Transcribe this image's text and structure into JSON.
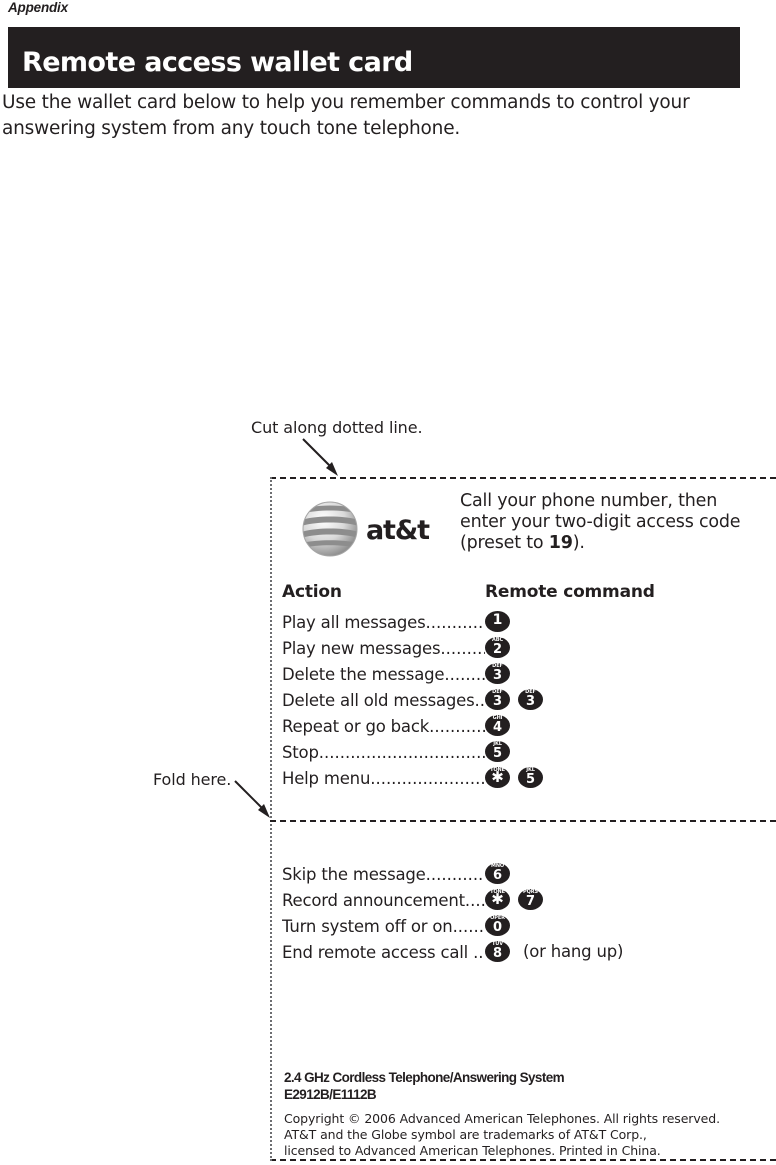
{
  "page": {
    "appendix_label": "Appendix",
    "title": "Remote access wallet card",
    "intro": "Use the wallet card below to help you remember commands to control your answering system from any touch tone telephone.",
    "cut_annotation": "Cut along dotted line.",
    "fold_annotation": "Fold here."
  },
  "card": {
    "brand": {
      "wordmark": "at&t",
      "globe_icon": "att-globe-icon"
    },
    "instructions": {
      "line1": "Call your phone number, then",
      "line2": "enter your two-digit access code",
      "line3_prefix": "(preset to ",
      "access_code": "19",
      "line3_suffix": ")."
    },
    "table": {
      "header_action": "Action",
      "header_command": "Remote command",
      "rows_top": [
        {
          "action": "Play all messages",
          "leader": "..................",
          "keys": [
            {
              "digit": "1",
              "sub": ""
            }
          ],
          "suffix": ""
        },
        {
          "action": "Play new messages",
          "leader": "...............",
          "keys": [
            {
              "digit": "2",
              "sub": "ABC"
            }
          ],
          "suffix": ""
        },
        {
          "action": "Delete the message",
          "leader": "..............",
          "keys": [
            {
              "digit": "3",
              "sub": "DEF"
            }
          ],
          "suffix": ""
        },
        {
          "action": "Delete all old messages",
          "leader": ".....",
          "keys": [
            {
              "digit": "3",
              "sub": "DEF"
            },
            {
              "digit": "3",
              "sub": "DEF"
            }
          ],
          "suffix": ""
        },
        {
          "action": "Repeat or go back",
          "leader": ".................",
          "keys": [
            {
              "digit": "4",
              "sub": "GHI"
            }
          ],
          "suffix": ""
        },
        {
          "action": "Stop",
          "leader": "...............................................",
          "keys": [
            {
              "digit": "5",
              "sub": "JKL"
            }
          ],
          "suffix": ""
        },
        {
          "action": "Help menu",
          "leader": "..................................",
          "keys": [
            {
              "digit": "✱",
              "sub": "TONE"
            },
            {
              "digit": "5",
              "sub": "JKL"
            }
          ],
          "suffix": ""
        }
      ],
      "rows_bottom": [
        {
          "action": "Skip the message",
          "leader": "...................",
          "keys": [
            {
              "digit": "6",
              "sub": "MNO"
            }
          ],
          "suffix": ""
        },
        {
          "action": "Record announcement",
          "leader": "........",
          "keys": [
            {
              "digit": "✱",
              "sub": "TONE"
            },
            {
              "digit": "7",
              "sub": "PQRS"
            }
          ],
          "suffix": ""
        },
        {
          "action": "Turn system off or on",
          "leader": "........",
          "keys": [
            {
              "digit": "0",
              "sub": "OPER"
            }
          ],
          "suffix": ""
        },
        {
          "action": "End remote access call ",
          "leader": "......",
          "keys": [
            {
              "digit": "8",
              "sub": "TUV"
            }
          ],
          "suffix": "(or hang up)"
        }
      ]
    },
    "footer": {
      "product_line": "2.4 GHz Cordless Telephone/Answering System",
      "model_line": "E2912B/E1112B",
      "copyright_line1": "Copyright © 2006 Advanced American Telephones.  All rights reserved.",
      "copyright_line2": "AT&T and the Globe symbol are trademarks of AT&T Corp.,",
      "copyright_line3": "licensed to Advanced American Telephones. Printed in China."
    }
  },
  "colors": {
    "ink": "#231f20",
    "paper": "#ffffff",
    "dotted_gray": "#6d6e71"
  }
}
